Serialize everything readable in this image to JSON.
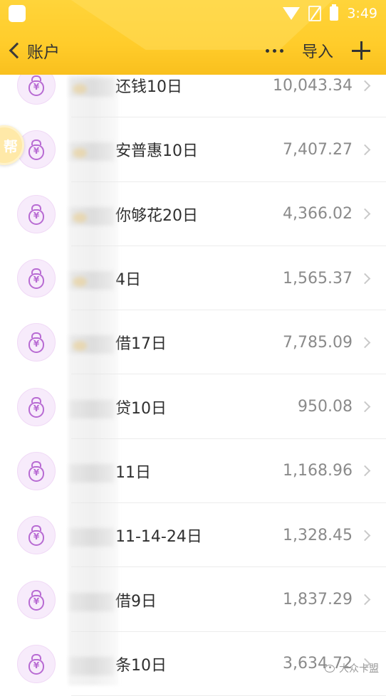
{
  "status_bar": {
    "time": "3:49"
  },
  "nav": {
    "back_label": "账户",
    "import_label": "导入"
  },
  "floating_badge": {
    "text": "帮"
  },
  "accounts": [
    {
      "name": "钱10日",
      "prefix": "还",
      "amount": "10,043.34"
    },
    {
      "name": "普惠10日",
      "prefix": "安",
      "amount": "7,407.27"
    },
    {
      "name": "够花20日",
      "prefix": "你",
      "amount": "4,366.02"
    },
    {
      "name": "4日",
      "prefix": "",
      "amount": "1,565.37"
    },
    {
      "name": "借17日",
      "prefix": "",
      "amount": "7,785.09"
    },
    {
      "name": "贷10日",
      "prefix": "",
      "amount": "950.08"
    },
    {
      "name": "11日",
      "prefix": "",
      "amount": "1,168.96"
    },
    {
      "name": "11-14-24日",
      "prefix": "",
      "amount": "1,328.45"
    },
    {
      "name": "借9日",
      "prefix": "",
      "amount": "1,837.29"
    },
    {
      "name": "条10日",
      "prefix": "",
      "amount": "3,634.72"
    }
  ],
  "watermark": {
    "text": "大众卡盟"
  },
  "colors": {
    "header": "#ffcc2a",
    "icon_accent": "#b86bd3",
    "icon_bg": "#f7ebfb"
  }
}
